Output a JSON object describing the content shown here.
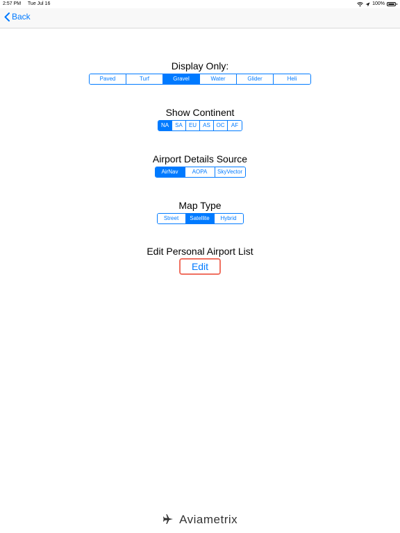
{
  "status_bar": {
    "time": "2:57 PM",
    "date": "Tue Jul 16",
    "battery": "100%",
    "icons": [
      "wifi-icon",
      "location-arrow-icon",
      "battery-icon"
    ]
  },
  "nav": {
    "back_label": "Back",
    "back_icon": "chevron-left-icon"
  },
  "display_only": {
    "title": "Display Only:",
    "options": [
      "Paved",
      "Turf",
      "Gravel",
      "Water",
      "Glider",
      "Heli"
    ],
    "selected": "Gravel"
  },
  "continent": {
    "title": "Show Continent",
    "options": [
      "NA",
      "SA",
      "EU",
      "AS",
      "OC",
      "AF"
    ],
    "selected": "NA"
  },
  "source": {
    "title": "Airport Details Source",
    "options": [
      "AirNav",
      "AOPA",
      "SkyVector"
    ],
    "selected": "AirNav"
  },
  "map_type": {
    "title": "Map Type",
    "options": [
      "Street",
      "Satellite",
      "Hybrid"
    ],
    "selected": "Satellite"
  },
  "personal_list": {
    "title": "Edit Personal Airport List",
    "button_label": "Edit"
  },
  "footer": {
    "logo_text": "Aviametrix",
    "logo_icon": "airplane-icon"
  },
  "colors": {
    "accent": "#007aff",
    "highlight_border": "#f07060"
  }
}
